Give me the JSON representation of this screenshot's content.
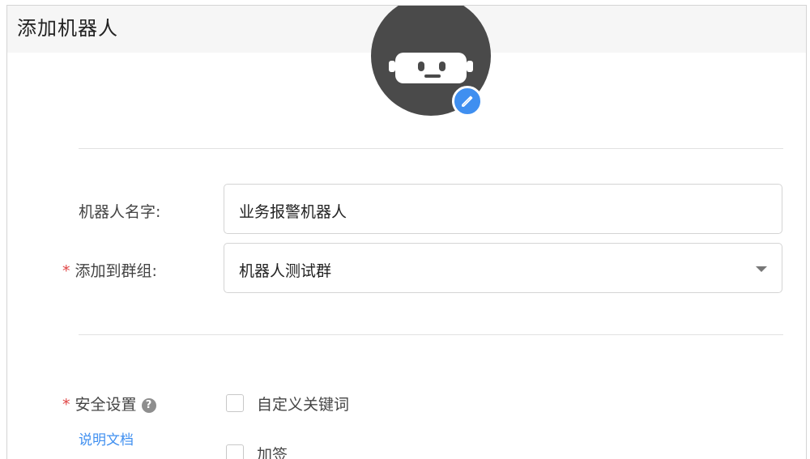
{
  "dialog": {
    "title": "添加机器人",
    "avatar_edit_icon": "pencil-icon",
    "avatar_icon": "robot-icon"
  },
  "form": {
    "name_label": "机器人名字:",
    "name_value": "业务报警机器人",
    "group_required_mark": "*",
    "group_label": "添加到群组:",
    "group_value": "机器人测试群",
    "group_dropdown_icon": "caret-down-icon",
    "security_required_mark": "*",
    "security_label": "安全设置",
    "security_help_icon": "question-circle-icon",
    "security_help_glyph": "?",
    "doc_link": "说明文档",
    "options": [
      {
        "label": "自定义关键词",
        "checked": false
      },
      {
        "label": "加签",
        "checked": false
      }
    ]
  },
  "colors": {
    "accent": "#3f8ff0",
    "required": "#e04545",
    "avatar_bg": "#4a4a4a"
  }
}
